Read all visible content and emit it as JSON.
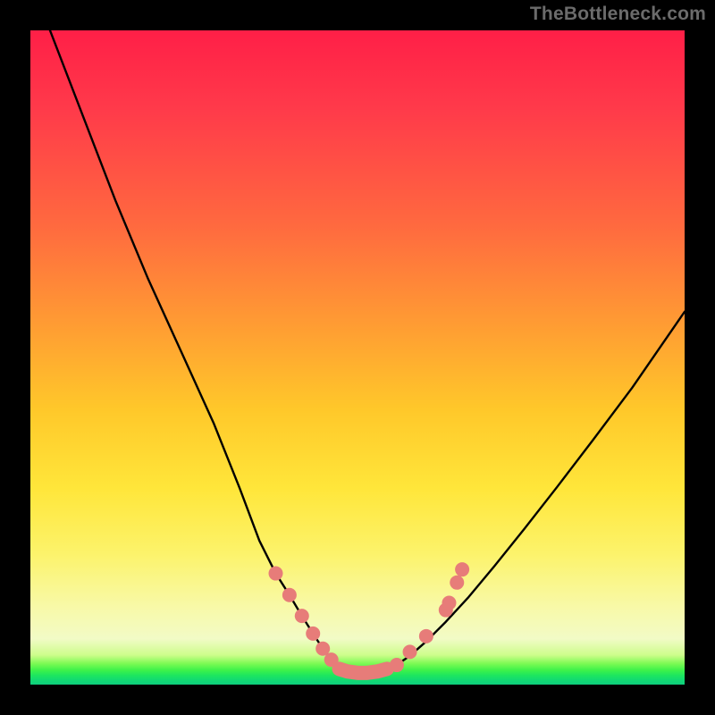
{
  "watermark": {
    "text": "TheBottleneck.com"
  },
  "colors": {
    "curve_stroke": "#000000",
    "marker_fill": "#e77c79",
    "marker_stroke": "#e77c79"
  },
  "chart_data": {
    "type": "line",
    "title": "",
    "xlabel": "",
    "ylabel": "",
    "xlim": [
      0,
      100
    ],
    "ylim": [
      0,
      100
    ],
    "grid": false,
    "legend": null,
    "series": [
      {
        "name": "left-branch",
        "x": [
          3,
          8,
          13,
          18,
          23,
          28,
          32,
          35,
          37.5,
          39.6,
          41.5,
          43.2,
          44.7,
          46,
          47.2
        ],
        "y": [
          100,
          87,
          74,
          62,
          51,
          40,
          30,
          22,
          17,
          13.7,
          10.5,
          7.8,
          5.5,
          3.8,
          2.6
        ]
      },
      {
        "name": "trough",
        "x": [
          47.2,
          48.5,
          50,
          51.5,
          53,
          54.5,
          56
        ],
        "y": [
          2.6,
          2.0,
          1.8,
          1.8,
          2.0,
          2.4,
          3.0
        ]
      },
      {
        "name": "right-branch",
        "x": [
          56,
          58,
          60.5,
          63.5,
          67,
          71,
          75.5,
          80.5,
          86,
          92,
          100
        ],
        "y": [
          3.0,
          4.4,
          6.6,
          9.6,
          13.4,
          18.2,
          23.8,
          30.2,
          37.4,
          45.4,
          57
        ]
      }
    ],
    "markers": {
      "comment": "salmon dots clustered on both sides of the trough and across the flat bottom (approx. readings)",
      "left_branch": [
        {
          "x": 37.5,
          "y": 17.0
        },
        {
          "x": 39.6,
          "y": 13.7
        },
        {
          "x": 41.5,
          "y": 10.5
        },
        {
          "x": 43.2,
          "y": 7.8
        },
        {
          "x": 44.7,
          "y": 5.5
        },
        {
          "x": 46.0,
          "y": 3.8
        }
      ],
      "trough_bar": [
        {
          "x": 47.2,
          "y": 2.4
        },
        {
          "x": 48.5,
          "y": 2.0
        },
        {
          "x": 50.0,
          "y": 1.8
        },
        {
          "x": 51.5,
          "y": 1.8
        },
        {
          "x": 53.0,
          "y": 2.0
        },
        {
          "x": 54.5,
          "y": 2.4
        }
      ],
      "right_branch": [
        {
          "x": 56.0,
          "y": 3.0
        },
        {
          "x": 58.0,
          "y": 5.0
        },
        {
          "x": 60.5,
          "y": 7.4
        },
        {
          "x": 63.5,
          "y": 11.4
        },
        {
          "x": 64.0,
          "y": 12.5
        },
        {
          "x": 65.2,
          "y": 15.6
        },
        {
          "x": 66.0,
          "y": 17.6
        }
      ]
    }
  }
}
